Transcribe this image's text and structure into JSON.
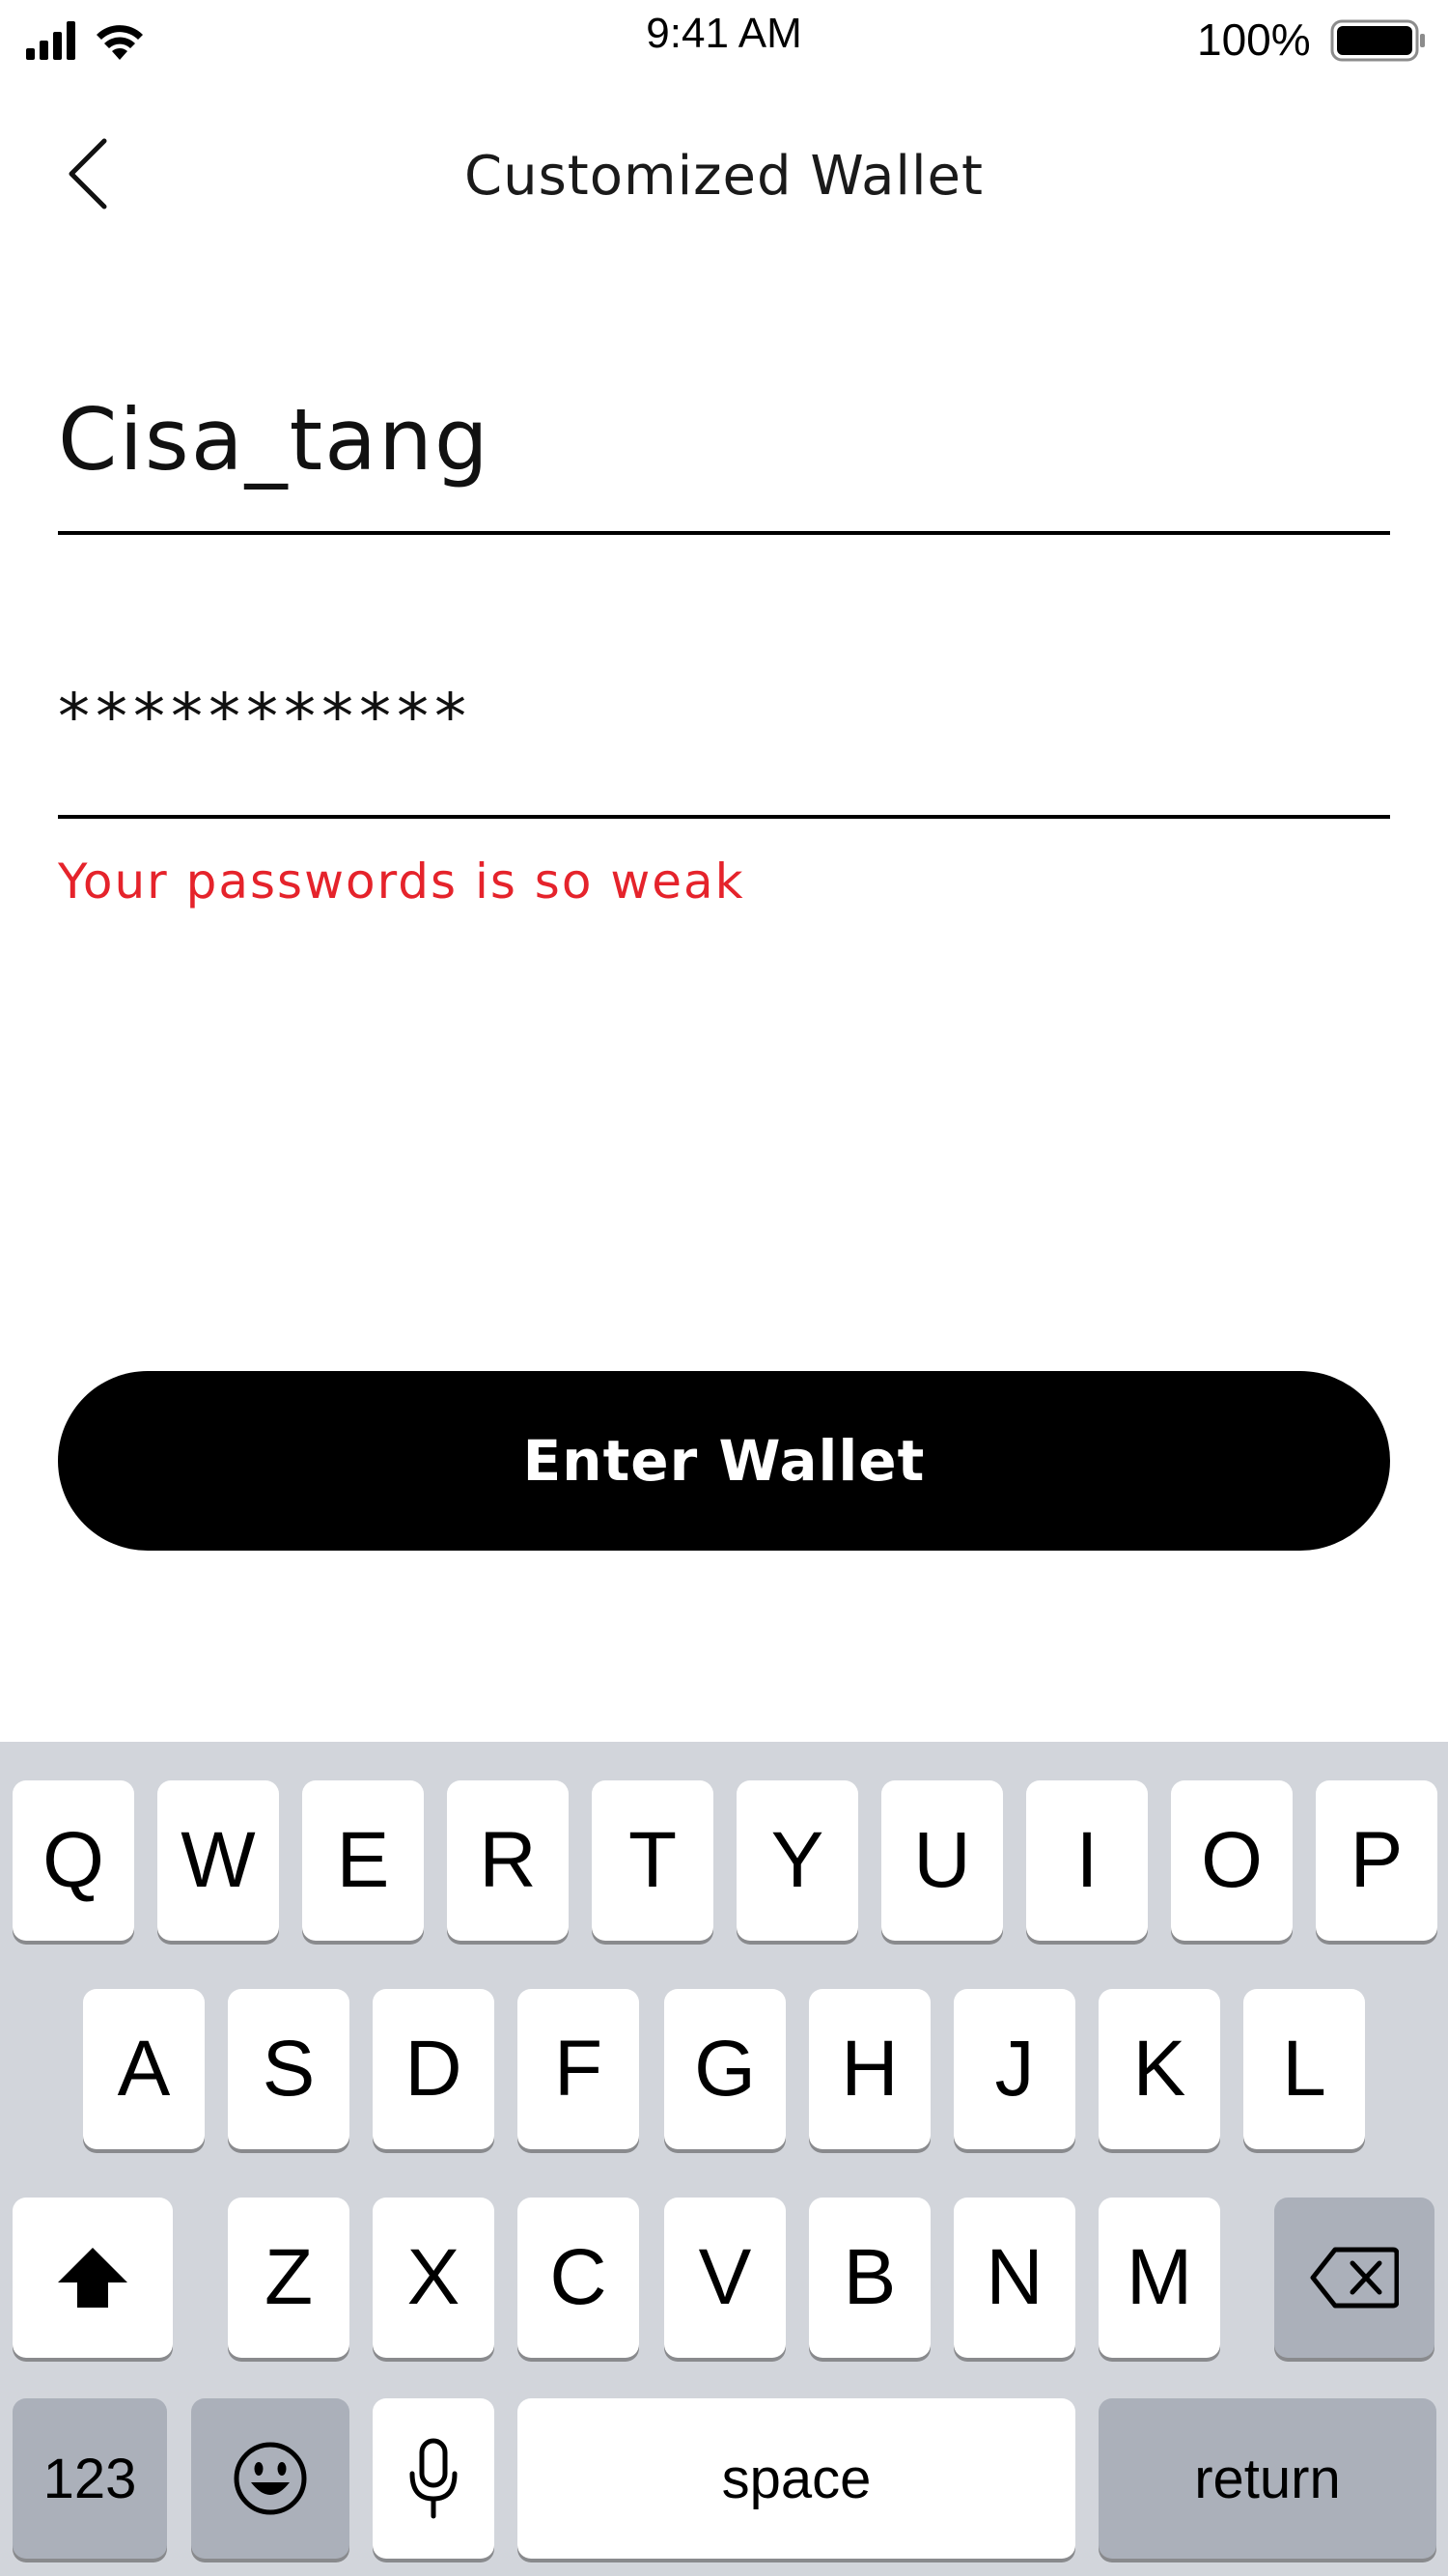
{
  "status_bar": {
    "time": "9:41 AM",
    "battery_percent": "100%",
    "signal_icon": "cellular-signal-icon",
    "wifi_icon": "wifi-icon",
    "battery_icon": "battery-icon"
  },
  "nav": {
    "back_icon": "chevron-left-icon",
    "title": "Customized Wallet"
  },
  "form": {
    "username_value": "Cisa_tang",
    "password_value": "***********",
    "password_error": "Your passwords is so weak",
    "error_color": "#e5232b"
  },
  "cta": {
    "label": "Enter Wallet",
    "background": "#000000"
  },
  "keyboard": {
    "row1": [
      "Q",
      "W",
      "E",
      "R",
      "T",
      "Y",
      "U",
      "I",
      "O",
      "P"
    ],
    "row2": [
      "A",
      "S",
      "D",
      "F",
      "G",
      "H",
      "J",
      "K",
      "L"
    ],
    "row3": [
      "Z",
      "X",
      "C",
      "V",
      "B",
      "N",
      "M"
    ],
    "shift_icon": "shift-arrow-icon",
    "delete_icon": "backspace-icon",
    "numbers_label": "123",
    "emoji_icon": "emoji-icon",
    "mic_icon": "microphone-icon",
    "space_label": "space",
    "return_label": "return"
  }
}
